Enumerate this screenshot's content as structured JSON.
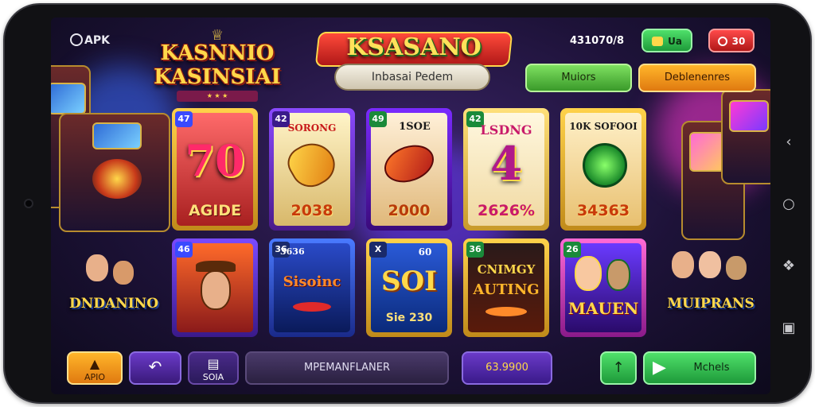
{
  "header": {
    "apk_label": "APK",
    "brand_line1": "KASNNIO",
    "brand_line2": "KASINSIAI",
    "game_title": "KSASANO",
    "search_label": "Inbasai Pedem",
    "balance": "431070/8",
    "btn_green_top": "Ua",
    "btn_red_top": "30",
    "btn_mid_green": "Muiors",
    "btn_mid_orange": "Deblenenres"
  },
  "tiles_row1": [
    {
      "badge": "47",
      "top": "",
      "art": "70",
      "bottom": "AGIDE",
      "theme": "red"
    },
    {
      "badge": "42",
      "top": "SORONG",
      "art": "",
      "bottom": "2038",
      "theme": "purple"
    },
    {
      "badge": "49",
      "top": "1SOE",
      "art": "",
      "bottom": "2000",
      "theme": "green"
    },
    {
      "badge": "42",
      "top": "LSDNG",
      "art": "4",
      "bottom": "2626%",
      "theme": "gold"
    },
    {
      "badge": "",
      "top": "10K SOFOOI",
      "art": "",
      "bottom": "34363",
      "theme": "gold"
    }
  ],
  "tiles_row2": [
    {
      "badge": "46",
      "top": "",
      "art": "",
      "bottom": "",
      "theme": "redwood"
    },
    {
      "badge": "36",
      "top": "3636",
      "art": "Sisoinc",
      "bottom": "",
      "theme": "blue"
    },
    {
      "badge": "X",
      "top": "60",
      "art": "SOI",
      "bottom": "Sie 230",
      "theme": "blue2"
    },
    {
      "badge": "36",
      "top": "CNIMGY",
      "art": "AUTING",
      "bottom": "",
      "theme": "dark"
    },
    {
      "badge": "26",
      "top": "",
      "art": "MAUEN",
      "bottom": "",
      "theme": "purple2"
    }
  ],
  "side_left": "DNDANINO",
  "side_right": "MUIPRANS",
  "bottom_bar": {
    "btn1_label": "APIO",
    "btn3_label": "SOIA",
    "center_label": "MPEMANFLANER",
    "amount": "63.9900",
    "play_label": "Mchels"
  },
  "icons": {
    "home": "home-icon",
    "back": "back-arrow-icon",
    "bag": "bag-icon",
    "up": "arrow-up-icon",
    "play": "play-icon"
  },
  "colors": {
    "accent_gold": "#ffd84a",
    "accent_red": "#b01818",
    "accent_green": "#2ea84a",
    "bg_purple": "#1d1238"
  }
}
